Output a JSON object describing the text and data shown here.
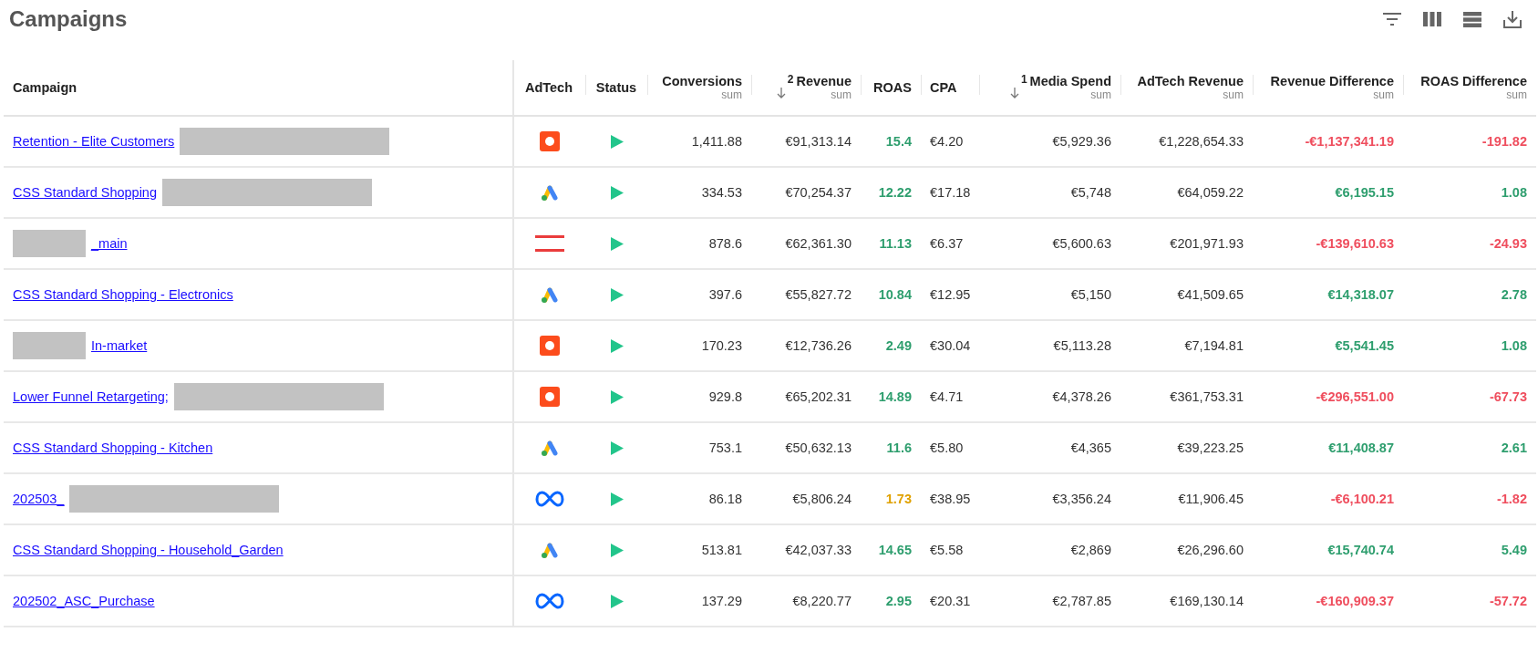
{
  "title": "Campaigns",
  "toolbar": [
    {
      "kind": "filter"
    },
    {
      "kind": "columns"
    },
    {
      "kind": "rows"
    },
    {
      "kind": "download"
    }
  ],
  "columns": [
    {
      "label": "Campaign"
    },
    {
      "label": "AdTech"
    },
    {
      "label": "Status"
    },
    {
      "label": "Conversions",
      "sub": "sum"
    },
    {
      "label": "Revenue",
      "sub": "sum",
      "sort_rank": "2"
    },
    {
      "label": "ROAS"
    },
    {
      "label": "CPA"
    },
    {
      "label": "Media Spend",
      "sub": "sum",
      "sort_rank": "1"
    },
    {
      "label": "AdTech Revenue",
      "sub": "sum"
    },
    {
      "label": "Revenue Difference",
      "sub": "sum"
    },
    {
      "label": "ROAS Difference",
      "sub": "sum"
    }
  ],
  "rows": [
    {
      "campaign": "Retention - Elite Customers",
      "redacted_before": false,
      "redacted_after": true,
      "adtech": {
        "kind": "ring"
      },
      "active": true,
      "conversions": "1,411.88",
      "revenue": "€91,313.14",
      "roas": {
        "text": "15.4",
        "color": "#2e9e6e"
      },
      "cpa": "€4.20",
      "media_spend": "€5,929.36",
      "adtech_revenue": "€1,228,654.33",
      "revenue_difference": {
        "text": "-€1,137,341.19",
        "color": "#ef4e5e"
      },
      "roas_difference": {
        "text": "-191.82",
        "color": "#ef4e5e"
      }
    },
    {
      "campaign": "CSS Standard Shopping",
      "redacted_before": false,
      "redacted_after": true,
      "adtech": {
        "kind": "triangle"
      },
      "active": true,
      "conversions": "334.53",
      "revenue": "€70,254.37",
      "roas": {
        "text": "12.22",
        "color": "#2e9e6e"
      },
      "cpa": "€17.18",
      "media_spend": "€5,748",
      "adtech_revenue": "€64,059.22",
      "revenue_difference": {
        "text": "€6,195.15",
        "color": "#2e9e6e"
      },
      "roas_difference": {
        "text": "1.08",
        "color": "#2e9e6e"
      }
    },
    {
      "campaign": "_main",
      "redacted_before": true,
      "redacted_after": false,
      "adtech": {
        "kind": "lines"
      },
      "active": true,
      "conversions": "878.6",
      "revenue": "€62,361.30",
      "roas": {
        "text": "11.13",
        "color": "#2e9e6e"
      },
      "cpa": "€6.37",
      "media_spend": "€5,600.63",
      "adtech_revenue": "€201,971.93",
      "revenue_difference": {
        "text": "-€139,610.63",
        "color": "#ef4e5e"
      },
      "roas_difference": {
        "text": "-24.93",
        "color": "#ef4e5e"
      }
    },
    {
      "campaign": "CSS Standard Shopping - Electronics",
      "redacted_before": false,
      "redacted_after": false,
      "adtech": {
        "kind": "triangle"
      },
      "active": true,
      "conversions": "397.6",
      "revenue": "€55,827.72",
      "roas": {
        "text": "10.84",
        "color": "#2e9e6e"
      },
      "cpa": "€12.95",
      "media_spend": "€5,150",
      "adtech_revenue": "€41,509.65",
      "revenue_difference": {
        "text": "€14,318.07",
        "color": "#2e9e6e"
      },
      "roas_difference": {
        "text": "2.78",
        "color": "#2e9e6e"
      }
    },
    {
      "campaign": "In-market",
      "redacted_before": true,
      "redacted_after": false,
      "adtech": {
        "kind": "ring"
      },
      "active": true,
      "conversions": "170.23",
      "revenue": "€12,736.26",
      "roas": {
        "text": "2.49",
        "color": "#2e9e6e"
      },
      "cpa": "€30.04",
      "media_spend": "€5,113.28",
      "adtech_revenue": "€7,194.81",
      "revenue_difference": {
        "text": "€5,541.45",
        "color": "#2e9e6e"
      },
      "roas_difference": {
        "text": "1.08",
        "color": "#2e9e6e"
      }
    },
    {
      "campaign": "Lower Funnel Retargeting;",
      "redacted_before": false,
      "redacted_after": true,
      "adtech": {
        "kind": "ring"
      },
      "active": true,
      "conversions": "929.8",
      "revenue": "€65,202.31",
      "roas": {
        "text": "14.89",
        "color": "#2e9e6e"
      },
      "cpa": "€4.71",
      "media_spend": "€4,378.26",
      "adtech_revenue": "€361,753.31",
      "revenue_difference": {
        "text": "-€296,551.00",
        "color": "#ef4e5e"
      },
      "roas_difference": {
        "text": "-67.73",
        "color": "#ef4e5e"
      }
    },
    {
      "campaign": "CSS Standard Shopping - Kitchen",
      "redacted_before": false,
      "redacted_after": false,
      "adtech": {
        "kind": "triangle"
      },
      "active": true,
      "conversions": "753.1",
      "revenue": "€50,632.13",
      "roas": {
        "text": "11.6",
        "color": "#2e9e6e"
      },
      "cpa": "€5.80",
      "media_spend": "€4,365",
      "adtech_revenue": "€39,223.25",
      "revenue_difference": {
        "text": "€11,408.87",
        "color": "#2e9e6e"
      },
      "roas_difference": {
        "text": "2.61",
        "color": "#2e9e6e"
      }
    },
    {
      "campaign": "202503_",
      "redacted_before": false,
      "redacted_after": true,
      "adtech": {
        "kind": "loop"
      },
      "active": true,
      "conversions": "86.18",
      "revenue": "€5,806.24",
      "roas": {
        "text": "1.73",
        "color": "#e0a100"
      },
      "cpa": "€38.95",
      "media_spend": "€3,356.24",
      "adtech_revenue": "€11,906.45",
      "revenue_difference": {
        "text": "-€6,100.21",
        "color": "#ef4e5e"
      },
      "roas_difference": {
        "text": "-1.82",
        "color": "#ef4e5e"
      }
    },
    {
      "campaign": "CSS Standard Shopping - Household_Garden",
      "redacted_before": false,
      "redacted_after": false,
      "adtech": {
        "kind": "triangle"
      },
      "active": true,
      "conversions": "513.81",
      "revenue": "€42,037.33",
      "roas": {
        "text": "14.65",
        "color": "#2e9e6e"
      },
      "cpa": "€5.58",
      "media_spend": "€2,869",
      "adtech_revenue": "€26,296.60",
      "revenue_difference": {
        "text": "€15,740.74",
        "color": "#2e9e6e"
      },
      "roas_difference": {
        "text": "5.49",
        "color": "#2e9e6e"
      }
    },
    {
      "campaign": "202502_ASC_Purchase",
      "redacted_before": false,
      "redacted_after": false,
      "adtech": {
        "kind": "loop"
      },
      "active": true,
      "conversions": "137.29",
      "revenue": "€8,220.77",
      "roas": {
        "text": "2.95",
        "color": "#2e9e6e"
      },
      "cpa": "€20.31",
      "media_spend": "€2,787.85",
      "adtech_revenue": "€169,130.14",
      "revenue_difference": {
        "text": "-€160,909.37",
        "color": "#ef4e5e"
      },
      "roas_difference": {
        "text": "-57.72",
        "color": "#ef4e5e"
      }
    }
  ]
}
